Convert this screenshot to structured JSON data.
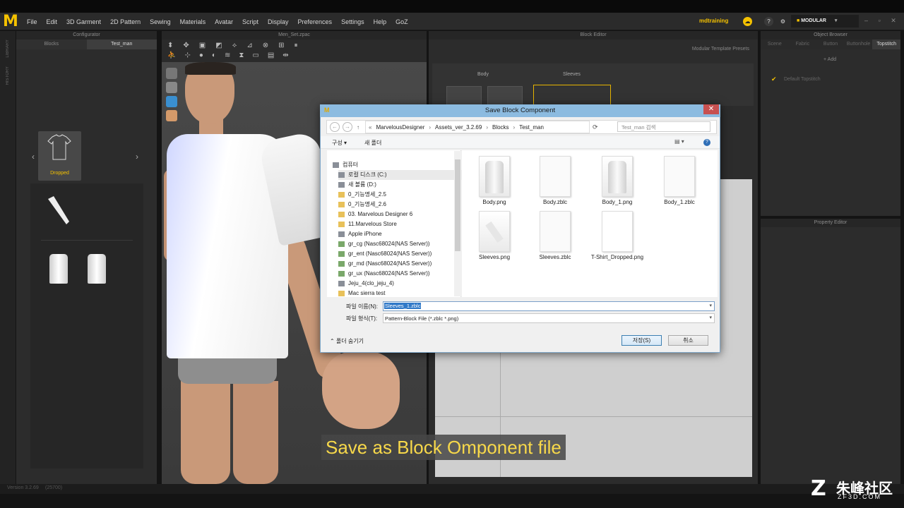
{
  "app": {
    "logo": "M",
    "menus": [
      "File",
      "Edit",
      "3D Garment",
      "2D Pattern",
      "Sewing",
      "Materials",
      "Avatar",
      "Script",
      "Display",
      "Preferences",
      "Settings",
      "Help",
      "GoZ"
    ],
    "user": "mdtraining",
    "mode": "MODULAR"
  },
  "configurator": {
    "title": "Configurator",
    "tabs": [
      "Blocks",
      "Test_man"
    ],
    "dropped_label": "Dropped"
  },
  "viewport": {
    "title": "Men_Set.zpac"
  },
  "block_editor": {
    "title": "Block Editor",
    "presets": "Modular Template Presets",
    "body": "Body",
    "sleeves": "Sleeves"
  },
  "object_browser": {
    "title": "Object Browser",
    "tabs": [
      "Scene",
      "Fabric",
      "Button",
      "Buttonhole",
      "Topstitch"
    ],
    "add": "Add",
    "default": "Default Topstitch"
  },
  "property_editor": {
    "title": "Property Editor"
  },
  "sidebar": {
    "labels": [
      "LIBRARY",
      "HISTORY"
    ]
  },
  "status": {
    "left": "Version 3.2.69",
    "right": "(25700)"
  },
  "dialog": {
    "title": "Save Block Component",
    "path": [
      "MarvelousDesigner",
      "Assets_ver_3.2.69",
      "Blocks",
      "Test_man"
    ],
    "search_placeholder": "Test_man 검색",
    "toolbar": {
      "organize": "구성 ▾",
      "new_folder": "새 폴더"
    },
    "tree": [
      "컴퓨터",
      "로컬 디스크 (C:)",
      "새 볼륨 (D:)",
      "0_기능명세_2.5",
      "0_기능명세_2.6",
      "03. Marvelous Designer 6",
      "11.Marvelous Store",
      "Apple iPhone",
      "gr_cg (Nasc68024(NAS Server))",
      "gr_ent (Nasc68024(NAS Server))",
      "gr_md (Nasc68024(NAS Server))",
      "gr_ux (Nasc68024(NAS Server))",
      "Jeju_4(clo_jeju_4)",
      "Mac sierra test"
    ],
    "files": [
      "Body.png",
      "Body.zblc",
      "Body_1.png",
      "Body_1.zblc",
      "Sleeves.png",
      "Sleeves.zblc",
      "T-Shirt_Dropped.png"
    ],
    "filename_label": "파일 이름(N):",
    "filename": "Sleeves_1.zblc",
    "filetype_label": "파일 형식(T):",
    "filetype": "Pattern-Block File (*.zblc *.png)",
    "hide_folders": "폴더 숨기기",
    "save": "저장(S)",
    "cancel": "취소"
  },
  "caption": "Save as Block Omponent file",
  "watermark": {
    "main": "朱峰社区",
    "sub": "ZF3D.COM"
  }
}
